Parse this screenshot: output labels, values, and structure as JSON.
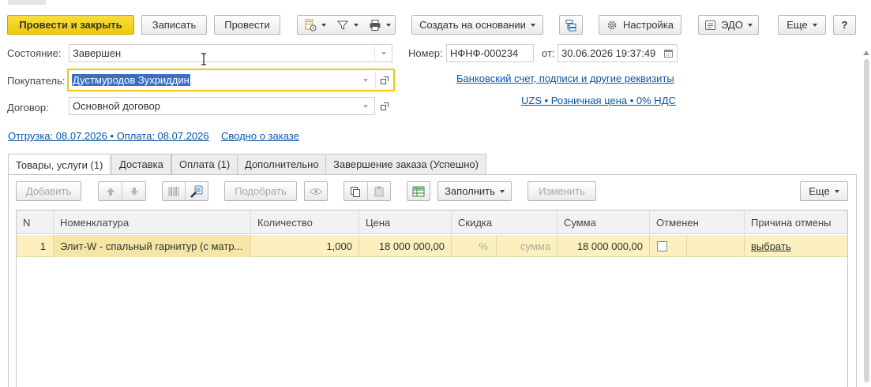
{
  "toolbar": {
    "post_and_close": "Провести и закрыть",
    "save": "Записать",
    "post": "Провести",
    "create_based_on": "Создать на основании",
    "settings": "Настройка",
    "edo": "ЭДО",
    "more": "Еще",
    "help": "?"
  },
  "fields": {
    "status_label": "Состояние:",
    "status_value": "Завершен",
    "number_label": "Номер:",
    "number_value": "НФНФ-000234",
    "date_label": "от:",
    "date_value": "30.06.2026 19:37:49",
    "buyer_label": "Покупатель:",
    "buyer_value": "Дустмуродов Зухриддин",
    "contract_label": "Договор:",
    "contract_value": "Основной договор"
  },
  "links": {
    "bank_account": "Банковский счет, подписи и другие реквизиты",
    "price_info": "UZS • Розничная цена • 0% НДС",
    "shipment_payment": "Отгрузка: 08.07.2026 • Оплата: 08.07.2026",
    "order_summary": "Сводно о заказе"
  },
  "tabs": [
    {
      "label": "Товары, услуги (1)",
      "active": true
    },
    {
      "label": "Доставка",
      "active": false
    },
    {
      "label": "Оплата (1)",
      "active": false
    },
    {
      "label": "Дополнительно",
      "active": false
    },
    {
      "label": "Завершение заказа (Успешно)",
      "active": false
    }
  ],
  "table_toolbar": {
    "add": "Добавить",
    "pick": "Подобрать",
    "fill": "Заполнить",
    "change": "Изменить",
    "more": "Еще"
  },
  "table": {
    "columns": [
      "N",
      "Номенклатура",
      "Количество",
      "Цена",
      "Скидка",
      "Сумма",
      "Отменен",
      "Причина отмены"
    ],
    "rows": [
      {
        "n": "1",
        "item": "Элит-W - спальный гарнитур (с матр...",
        "quantity": "1,000",
        "price": "18 000 000,00",
        "discount_percent": "%",
        "discount_sum": "сумма",
        "sum": "18 000 000,00",
        "cancelled": false,
        "cancel_reason": "выбрать"
      }
    ]
  },
  "colors": {
    "primary_button": "#f1c80a",
    "selected_row": "#fbf0be",
    "link": "#0a55a5",
    "focus_border": "#f1c80a"
  }
}
